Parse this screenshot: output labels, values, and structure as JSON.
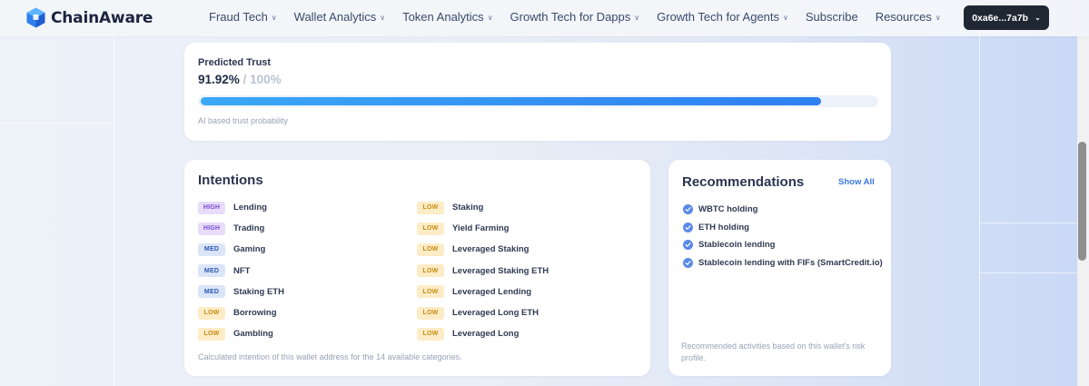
{
  "header": {
    "brand": "ChainAware",
    "nav": [
      {
        "label": "Fraud Tech",
        "chevron": true
      },
      {
        "label": "Wallet Analytics",
        "chevron": true
      },
      {
        "label": "Token Analytics",
        "chevron": true
      },
      {
        "label": "Growth Tech for Dapps",
        "chevron": true
      },
      {
        "label": "Growth Tech for Agents",
        "chevron": true
      },
      {
        "label": "Subscribe",
        "chevron": false
      },
      {
        "label": "Resources",
        "chevron": true
      }
    ],
    "wallet": "0xa6e...7a7b"
  },
  "trust": {
    "title": "Predicted Trust",
    "value": "91.92%",
    "max": "/ 100%",
    "fraction": 0.9192,
    "note": "AI based trust probability"
  },
  "intentions": {
    "title": "Intentions",
    "left": [
      {
        "level": "HIGH",
        "label": "Lending"
      },
      {
        "level": "HIGH",
        "label": "Trading"
      },
      {
        "level": "MED",
        "label": "Gaming"
      },
      {
        "level": "MED",
        "label": "NFT"
      },
      {
        "level": "MED",
        "label": "Staking ETH"
      },
      {
        "level": "LOW",
        "label": "Borrowing"
      },
      {
        "level": "LOW",
        "label": "Gambling"
      }
    ],
    "right": [
      {
        "level": "LOW",
        "label": "Staking"
      },
      {
        "level": "LOW",
        "label": "Yield Farming"
      },
      {
        "level": "LOW",
        "label": "Leveraged Staking"
      },
      {
        "level": "LOW",
        "label": "Leveraged Staking ETH"
      },
      {
        "level": "LOW",
        "label": "Leveraged Lending"
      },
      {
        "level": "LOW",
        "label": "Leveraged Long ETH"
      },
      {
        "level": "LOW",
        "label": "Leveraged Long"
      }
    ],
    "note": "Calculated intention of this wallet address for the 14 available categories."
  },
  "recommendations": {
    "title": "Recommendations",
    "show_all": "Show All",
    "items": [
      "WBTC holding",
      "ETH holding",
      "Stablecoin lending",
      "Stablecoin lending with FIFs (SmartCredit.io)"
    ],
    "note": "Recommended activities based on this wallet's risk profile."
  },
  "colors": {
    "accent": "#2f7ff0",
    "high": "#7a4bd6",
    "med": "#2f58b5",
    "low": "#c88a12"
  }
}
